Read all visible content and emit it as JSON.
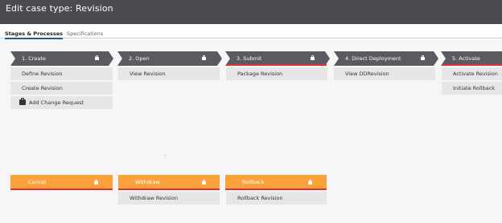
{
  "header": {
    "title": "Edit case type:  Revision"
  },
  "tabs": [
    {
      "label": "Stages & Processes",
      "active": true
    },
    {
      "label": "Specifications",
      "active": false
    }
  ],
  "colors": {
    "title_bar": "#4a4a4f",
    "stage_chevron": "#5a5a60",
    "stage_underline": "#e0303a",
    "alternate_stage": "#fba23b",
    "step_background": "#e6e6e6"
  },
  "stages": [
    {
      "label": "1.  Create",
      "locked": true,
      "steps": [
        "Define Revision",
        "Create Revision",
        "Add Change Request"
      ]
    },
    {
      "label": "2.  Open",
      "locked": true,
      "steps": [
        "View Revision"
      ]
    },
    {
      "label": "3.  Submit",
      "locked": true,
      "steps": [
        "Package Revision"
      ]
    },
    {
      "label": "4.  Direct Deployment",
      "locked": true,
      "steps": [
        "View DDRevision"
      ]
    },
    {
      "label": "5.  Activate",
      "locked": true,
      "steps": [
        "Activate Revision",
        "Initiate Rollback"
      ]
    }
  ],
  "alternate_stages": [
    {
      "label": "Cancel",
      "locked": true,
      "steps": []
    },
    {
      "label": "Withdraw",
      "locked": true,
      "steps": [
        "Withdraw Revision"
      ]
    },
    {
      "label": "Rollback",
      "locked": true,
      "steps": [
        "Rollback Revision"
      ]
    }
  ],
  "icons": {
    "lock": "lock-icon",
    "briefcase": "briefcase-icon"
  }
}
